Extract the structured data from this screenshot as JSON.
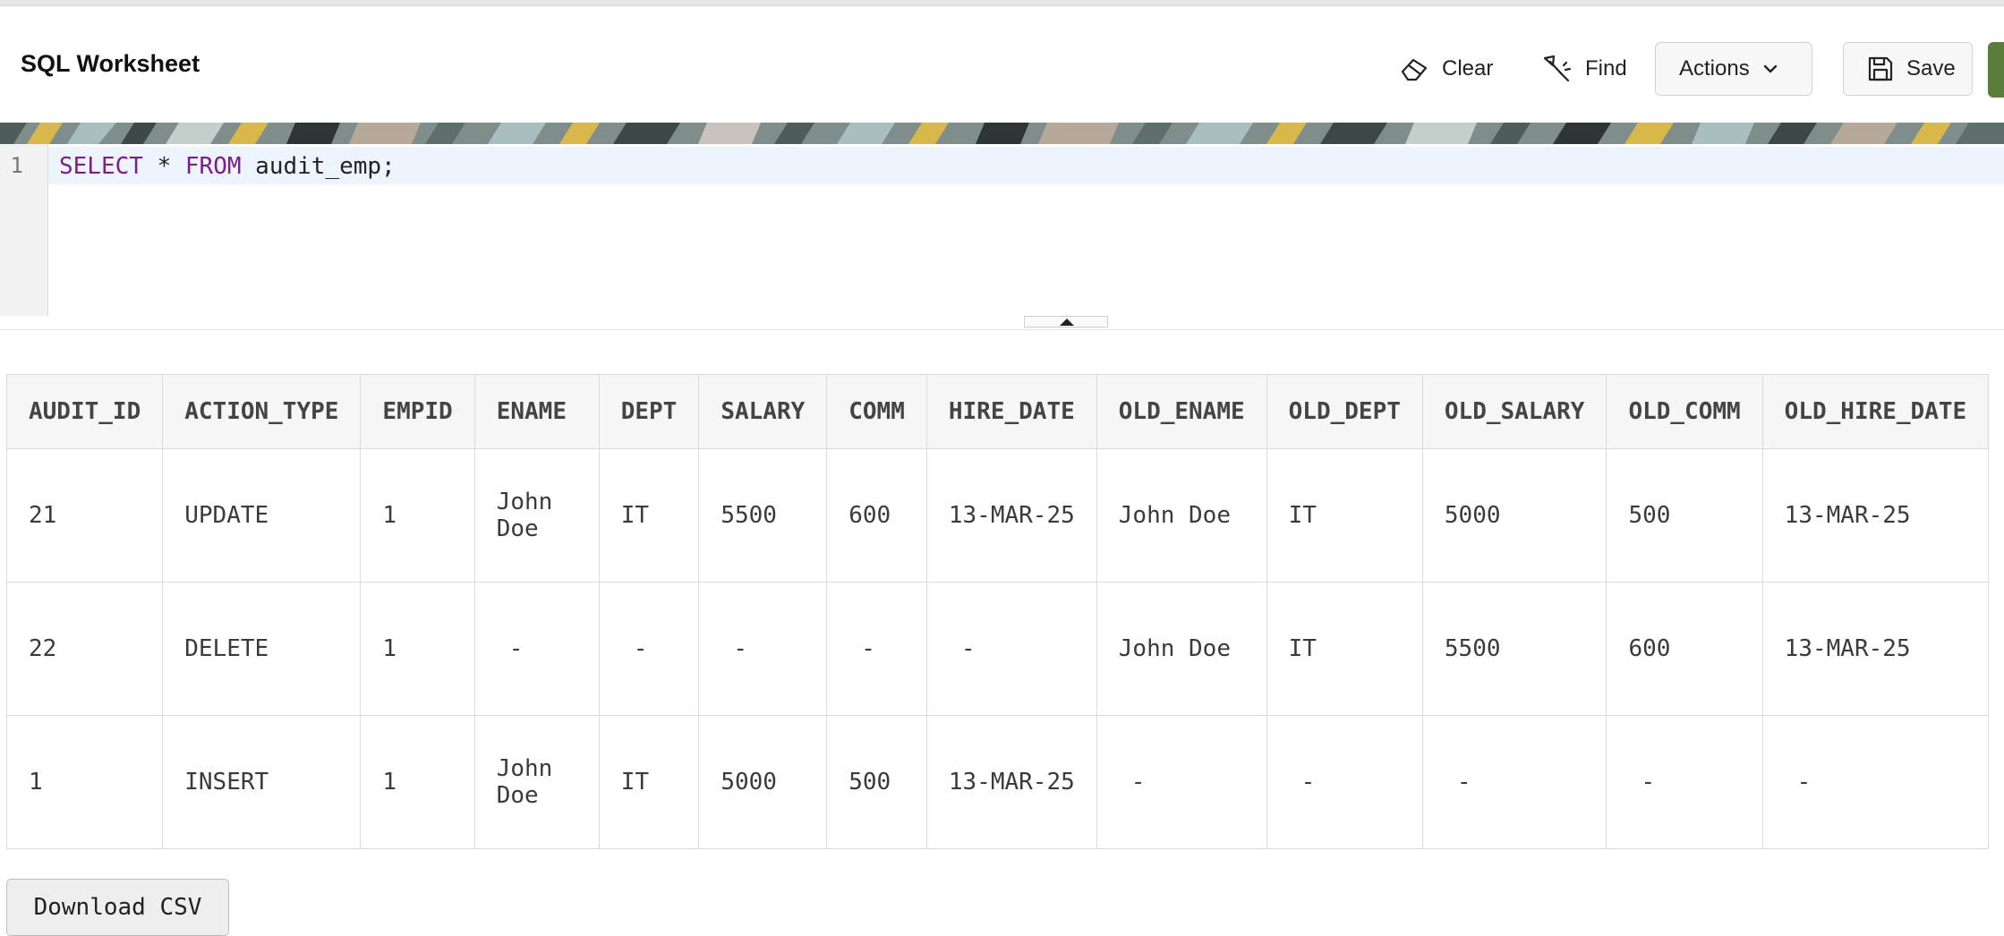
{
  "header": {
    "title": "SQL Worksheet",
    "clear_label": "Clear",
    "find_label": "Find",
    "actions_label": "Actions",
    "save_label": "Save",
    "accent_color": "#5a7d3c"
  },
  "editor": {
    "line_number": "1",
    "kw_select": "SELECT",
    "star": "*",
    "kw_from": "FROM",
    "table_name": "audit_emp;"
  },
  "results": {
    "columns": [
      "AUDIT_ID",
      "ACTION_TYPE",
      "EMPID",
      "ENAME",
      "DEPT",
      "SALARY",
      "COMM",
      "HIRE_DATE",
      "OLD_ENAME",
      "OLD_DEPT",
      "OLD_SALARY",
      "OLD_COMM",
      "OLD_HIRE_DATE"
    ],
    "rows": [
      [
        "21",
        "UPDATE",
        "1",
        "John Doe",
        "IT",
        "5500",
        "600",
        "13-MAR-25",
        "John Doe",
        "IT",
        "5000",
        "500",
        "13-MAR-25"
      ],
      [
        "22",
        "DELETE",
        "1",
        "-",
        "-",
        "-",
        "-",
        "-",
        "John Doe",
        "IT",
        "5500",
        "600",
        "13-MAR-25"
      ],
      [
        "1",
        "INSERT",
        "1",
        "John Doe",
        "IT",
        "5000",
        "500",
        "13-MAR-25",
        "-",
        "-",
        "-",
        "-",
        "-"
      ]
    ]
  },
  "download_label": "Download CSV",
  "icons": {
    "clear": "eraser-icon",
    "find": "flashlight-icon",
    "actions": "chevron-down-icon",
    "save": "floppy-disk-icon"
  }
}
